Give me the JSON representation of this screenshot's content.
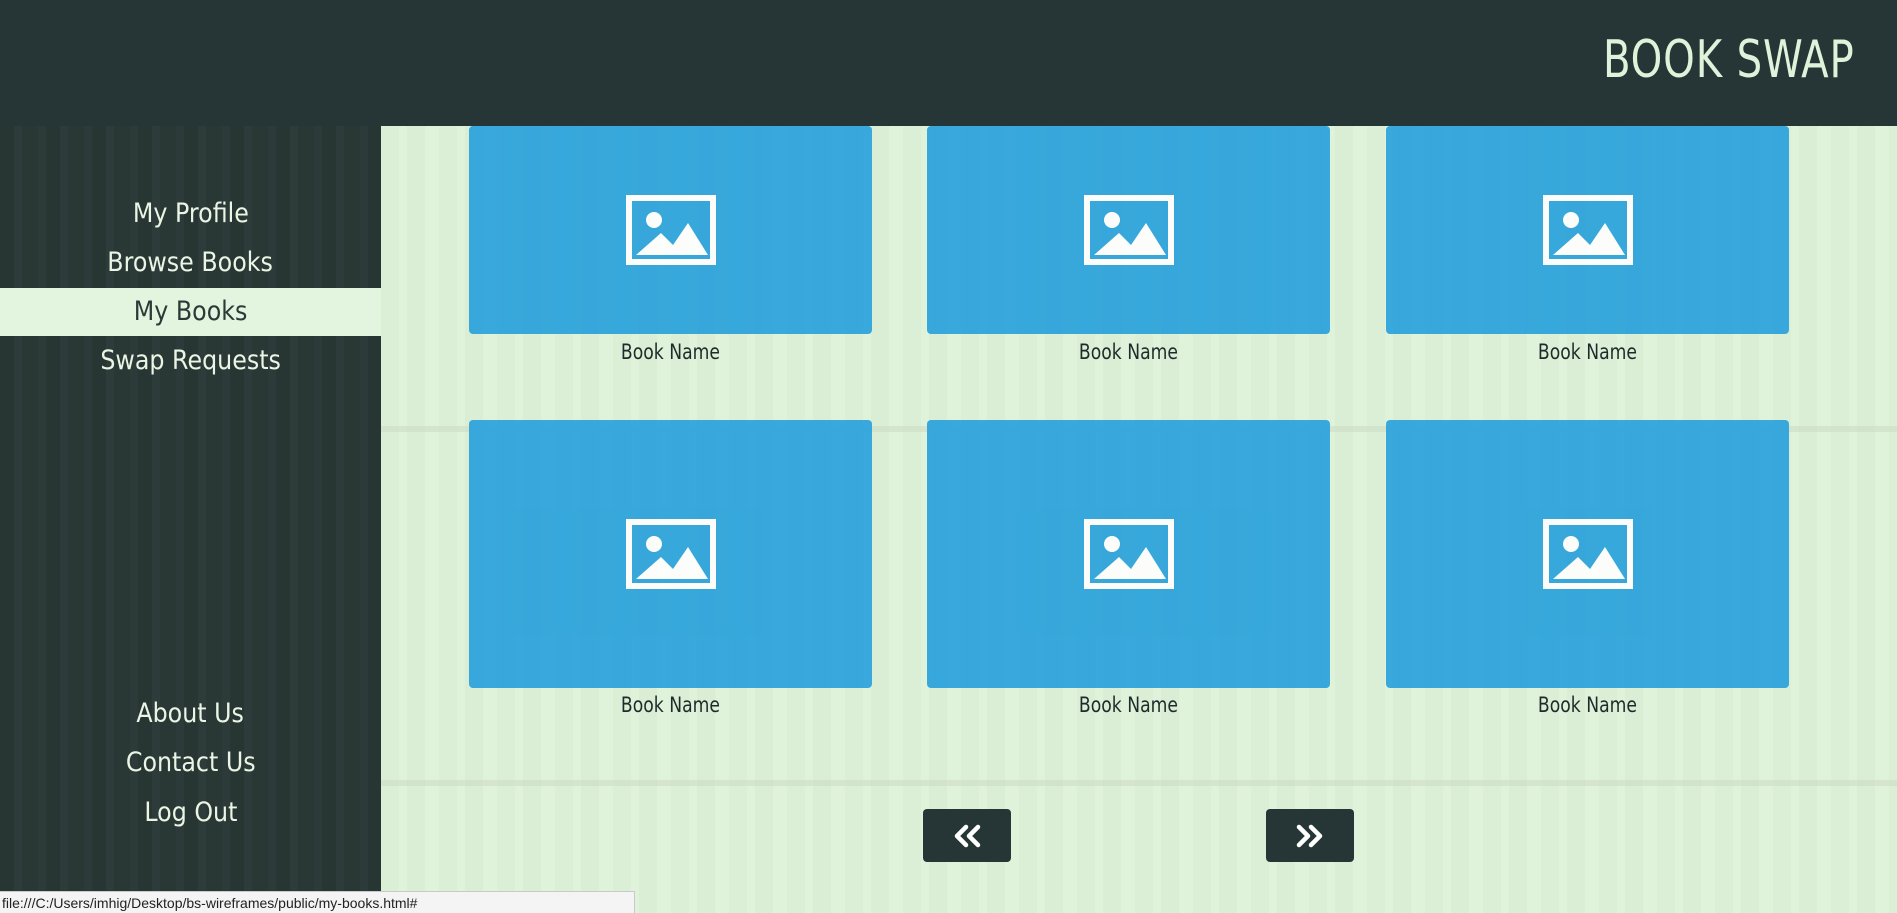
{
  "header": {
    "brand": "BOOK SWAP"
  },
  "sidebar": {
    "nav": [
      {
        "label": "My Profile",
        "active": false
      },
      {
        "label": "Browse Books",
        "active": false
      },
      {
        "label": "My Books",
        "active": true
      },
      {
        "label": "Swap Requests",
        "active": false
      }
    ],
    "footer": [
      {
        "label": "About Us"
      },
      {
        "label": "Contact Us"
      },
      {
        "label": "Log Out"
      }
    ]
  },
  "books": [
    {
      "name": "Book Name",
      "icon": "image-placeholder-icon"
    },
    {
      "name": "Book Name",
      "icon": "image-placeholder-icon"
    },
    {
      "name": "Book Name",
      "icon": "image-placeholder-icon"
    },
    {
      "name": "Book Name",
      "icon": "image-placeholder-icon"
    },
    {
      "name": "Book Name",
      "icon": "image-placeholder-icon"
    },
    {
      "name": "Book Name",
      "icon": "image-placeholder-icon"
    }
  ],
  "pagination": {
    "prev_icon": "double-chevron-left-icon",
    "next_icon": "double-chevron-right-icon"
  },
  "status_bar": {
    "url": "file:///C:/Users/imhig/Desktop/bs-wireframes/public/my-books.html#"
  },
  "colors": {
    "header_bg": "#263636",
    "sidebar_bg": "#2b3a38",
    "page_bg": "#dff3db",
    "card_bg": "#2aa2dc",
    "brand_text": "#dff3db"
  }
}
